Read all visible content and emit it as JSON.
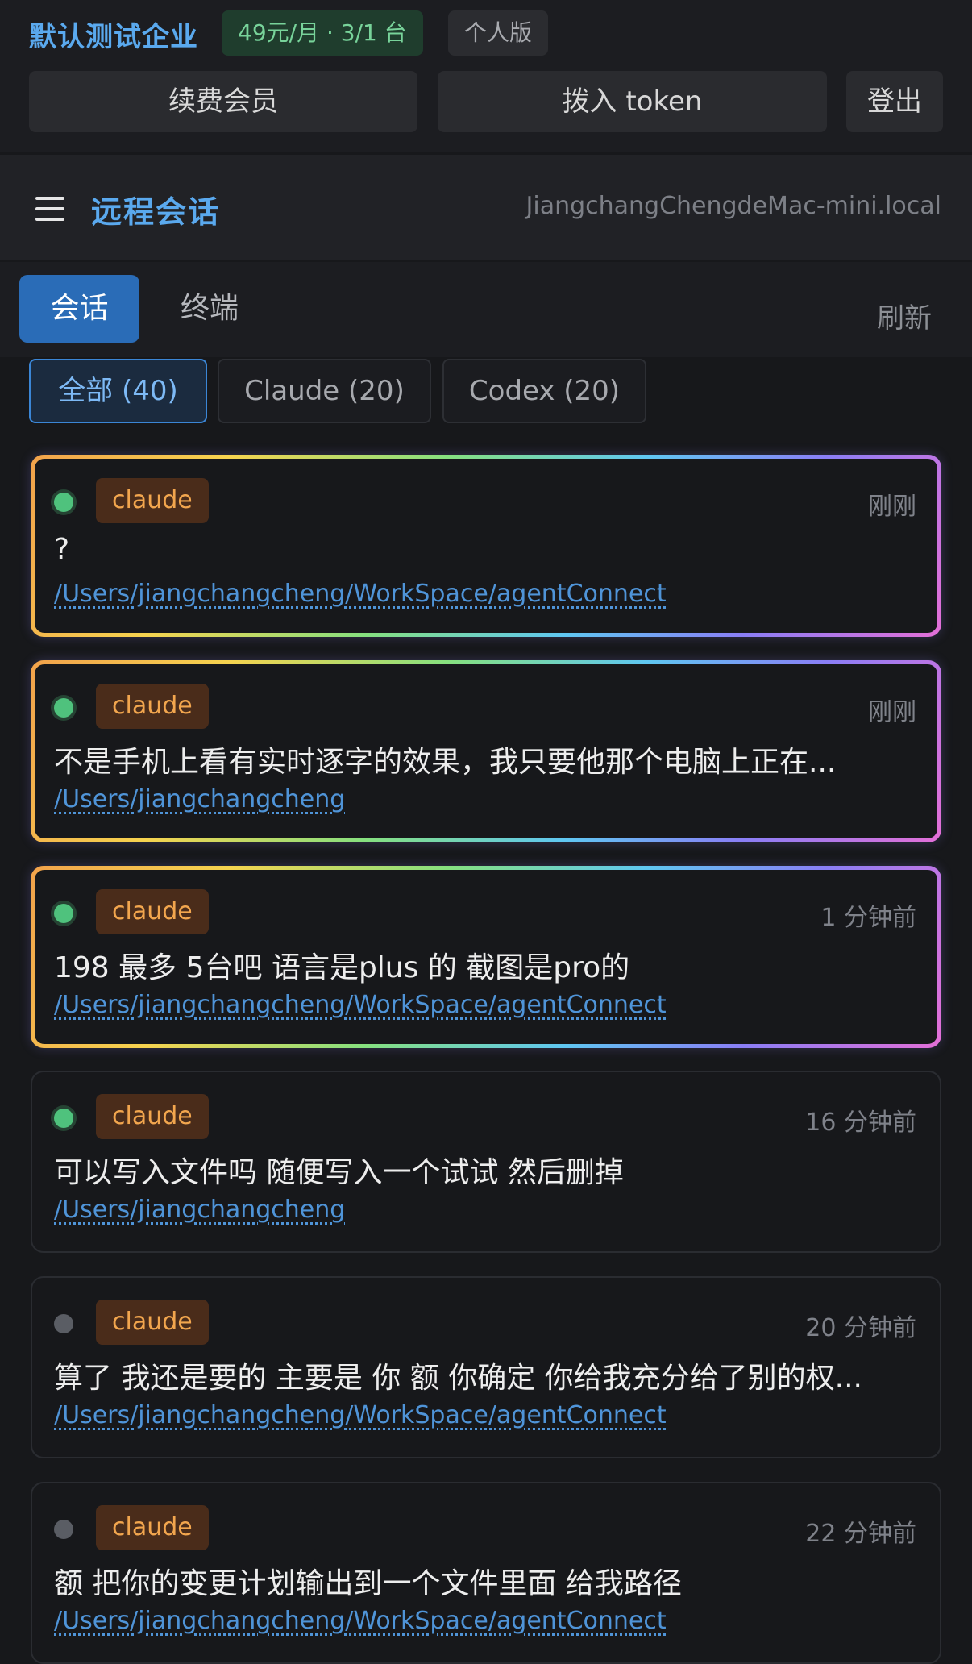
{
  "account": {
    "company": "默认测试企业",
    "plan": "49元/月 · 3/1 台",
    "edition": "个人版",
    "renew_label": "续费会员",
    "token_label": "拨入 token",
    "logout_label": "登出"
  },
  "header": {
    "title": "远程会话",
    "host": "JiangchangChengdeMac-mini.local"
  },
  "tabs": {
    "sessions": "会话",
    "terminal": "终端",
    "refresh": "刷新"
  },
  "filters": {
    "all": "全部 (40)",
    "claude": "Claude (20)",
    "codex": "Codex (20)"
  },
  "sessions": [
    {
      "agent": "claude",
      "time": "刚刚",
      "message": "?",
      "path": "/Users/jiangchangcheng/WorkSpace/agentConnect",
      "status": "online"
    },
    {
      "agent": "claude",
      "time": "刚刚",
      "message": "不是手机上看有实时逐字的效果，我只要他那个电脑上正在...",
      "path": "/Users/jiangchangcheng",
      "status": "online"
    },
    {
      "agent": "claude",
      "time": "1 分钟前",
      "message": "198 最多 5台吧 语言是plus 的 截图是pro的",
      "path": "/Users/jiangchangcheng/WorkSpace/agentConnect",
      "status": "online"
    },
    {
      "agent": "claude",
      "time": "16 分钟前",
      "message": "可以写入文件吗 随便写入一个试试 然后删掉",
      "path": "/Users/jiangchangcheng",
      "status": "online"
    },
    {
      "agent": "claude",
      "time": "20 分钟前",
      "message": "算了 我还是要的 主要是 你 额 你确定 你给我充分给了别的权...",
      "path": "/Users/jiangchangcheng/WorkSpace/agentConnect",
      "status": "idle"
    },
    {
      "agent": "claude",
      "time": "22 分钟前",
      "message": "额 把你的变更计划输出到一个文件里面 给我路径",
      "path": "/Users/jiangchangcheng/WorkSpace/agentConnect",
      "status": "idle"
    }
  ]
}
